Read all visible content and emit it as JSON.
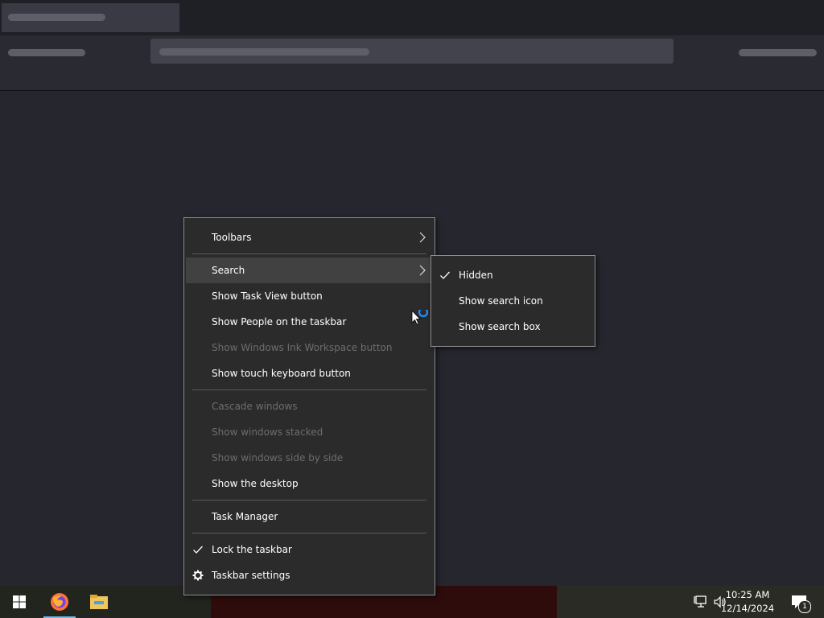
{
  "context_menu": {
    "items": [
      {
        "label": "Toolbars"
      },
      {
        "label": "Search"
      },
      {
        "label": "Show Task View button"
      },
      {
        "label": "Show People on the taskbar"
      },
      {
        "label": "Show Windows Ink Workspace button"
      },
      {
        "label": "Show touch keyboard button"
      },
      {
        "label": "Cascade windows"
      },
      {
        "label": "Show windows stacked"
      },
      {
        "label": "Show windows side by side"
      },
      {
        "label": "Show the desktop"
      },
      {
        "label": "Task Manager"
      },
      {
        "label": "Lock the taskbar"
      },
      {
        "label": "Taskbar settings"
      }
    ]
  },
  "search_submenu": {
    "items": [
      {
        "label": "Hidden",
        "checked": true
      },
      {
        "label": "Show search icon",
        "checked": false
      },
      {
        "label": "Show search box",
        "checked": false
      }
    ]
  },
  "taskbar": {
    "time": "10:25 AM",
    "date": "12/14/2024",
    "notification_count": "1",
    "pinned_apps": [
      "start-icon",
      "firefox-icon",
      "file-explorer-icon"
    ]
  },
  "colors": {
    "accent": "#76b9ed",
    "menu_bg": "#2b2b2b",
    "menu_highlight": "#414141",
    "disabled_text": "#6d6d6d"
  }
}
